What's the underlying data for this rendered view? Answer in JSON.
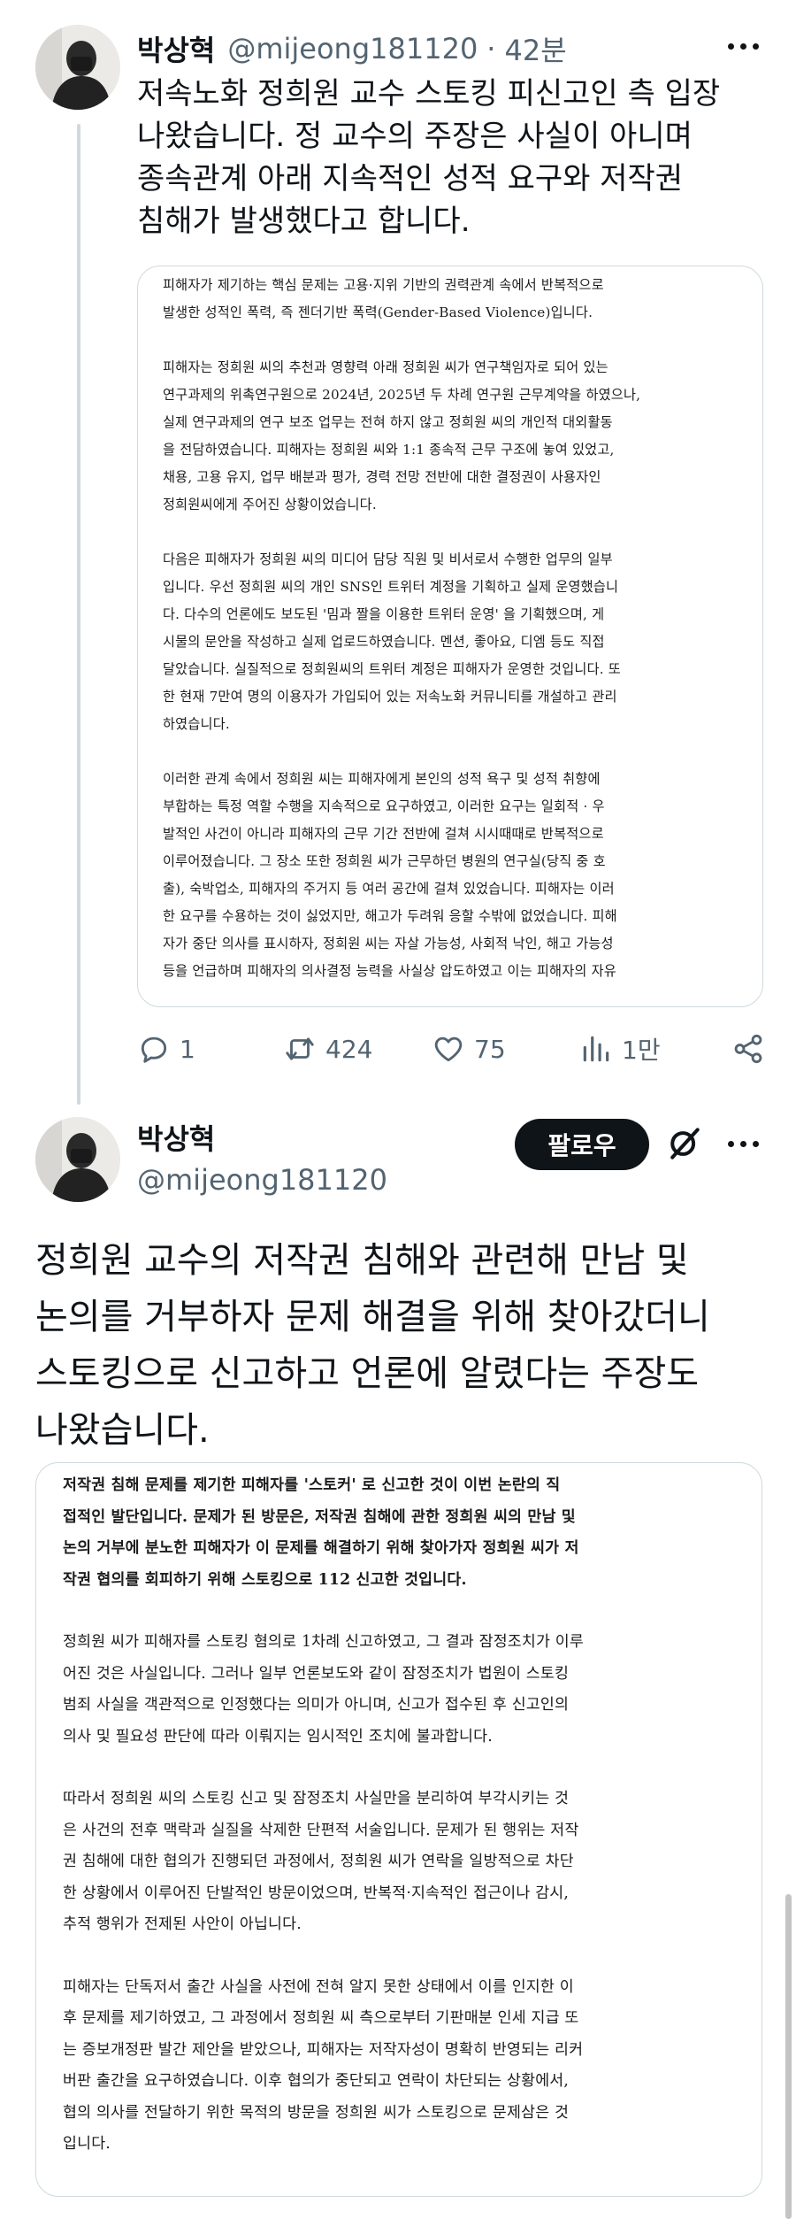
{
  "tweet1": {
    "author_name": "박상혁",
    "author_handle": "@mijeong181120",
    "separator": "·",
    "time": "42분",
    "text": "저속노화 정희원 교수 스토킹 피신고인 측 입장 나왔습니다. 정 교수의 주장은 사실이 아니며 종속관계 아래 지속적인 성적 요구와 저작권 침해가 발생했다고 합니다.",
    "document_paragraphs": [
      [
        "피해자가 제기하는 핵심 문제는 고용·지위 기반의 권력관계 속에서 반복적으로",
        "발생한 성적인 폭력, 즉 젠더기반 폭력(Gender-Based Violence)입니다."
      ],
      [
        "피해자는 정희원 씨의 추천과 영향력 아래 정희원 씨가 연구책임자로 되어 있는",
        "연구과제의 위촉연구원으로 2024년, 2025년 두 차례 연구원 근무계약을 하였으나,",
        "실제 연구과제의 연구 보조 업무는 전혀 하지 않고 정희원 씨의 개인적 대외활동",
        "을 전담하였습니다. 피해자는 정희원 씨와 1:1 종속적 근무 구조에 놓여 있었고,",
        "채용, 고용 유지, 업무 배분과 평가, 경력 전망 전반에 대한 결정권이 사용자인",
        "정희원씨에게 주어진 상황이었습니다."
      ],
      [
        "다음은 피해자가 정희원 씨의 미디어 담당 직원 및 비서로서 수행한 업무의 일부",
        "입니다. 우선 정희원 씨의 개인 SNS인 트위터 계정을 기획하고 실제 운영했습니",
        "다. 다수의 언론에도 보도된 '밈과 짤을 이용한 트위터 운영' 을 기획했으며, 게",
        "시물의 문안을 작성하고 실제 업로드하였습니다. 멘션, 좋아요, 디엠 등도 직접",
        "달았습니다. 실질적으로 정희원씨의 트위터 계정은 피해자가 운영한 것입니다. 또",
        "한 현재 7만여 명의 이용자가 가입되어 있는 저속노화 커뮤니티를 개설하고 관리",
        "하였습니다."
      ],
      [
        "이러한 관계 속에서 정희원 씨는 피해자에게 본인의 성적 욕구 및 성적 취향에",
        "부합하는 특정 역할 수행을 지속적으로 요구하였고, 이러한 요구는 일회적 · 우",
        "발적인 사건이 아니라 피해자의 근무 기간 전반에 걸쳐 시시때때로 반복적으로",
        "이루어졌습니다. 그 장소 또한 정희원 씨가 근무하던 병원의 연구실(당직 중 호",
        "출), 숙박업소, 피해자의 주거지 등 여러 공간에 걸쳐 있었습니다. 피해자는 이러",
        "한 요구를 수용하는 것이 싫었지만, 해고가 두려워 응할 수밖에 없었습니다. 피해",
        "자가 중단 의사를 표시하자, 정희원 씨는 자살 가능성, 사회적 낙인, 해고 가능성",
        "등을 언급하며 피해자의 의사결정 능력을 사실상 압도하였고 이는 피해자의 자유"
      ]
    ],
    "replies": "1",
    "retweets": "424",
    "likes": "75",
    "views": "1만"
  },
  "tweet2": {
    "author_name": "박상혁",
    "author_handle": "@mijeong181120",
    "follow_label": "팔로우",
    "text": "정희원 교수의 저작권 침해와 관련해 만남 및 논의를 거부하자 문제 해결을 위해 찾아갔더니 스토킹으로 신고하고 언론에 알렸다는 주장도 나왔습니다.",
    "document_paragraphs": [
      [
        "저작권 침해 문제를 제기한 피해자를 '스토커' 로 신고한 것이 이번 논란의 직",
        "접적인 발단입니다. 문제가 된 방문은, 저작권 침해에 관한 정희원 씨의 만남 및",
        "논의 거부에 분노한 피해자가 이 문제를 해결하기 위해 찾아가자 정희원 씨가 저",
        "작권 협의를 회피하기 위해 스토킹으로 112 신고한 것입니다."
      ],
      [
        "정희원 씨가 피해자를 스토킹 혐의로 1차례 신고하였고, 그 결과 잠정조치가 이루",
        "어진 것은 사실입니다. 그러나 일부 언론보도와 같이 잠정조치가 법원이 스토킹",
        "범죄 사실을 객관적으로 인정했다는 의미가 아니며, 신고가 접수된 후 신고인의",
        "의사 및 필요성 판단에 따라 이뤄지는 임시적인 조치에 불과합니다."
      ],
      [
        "따라서 정희원 씨의 스토킹 신고 및 잠정조치 사실만을 분리하여 부각시키는 것",
        "은 사건의 전후 맥락과 실질을 삭제한 단편적 서술입니다. 문제가 된 행위는 저작",
        "권 침해에 대한 협의가 진행되던 과정에서, 정희원 씨가 연락을 일방적으로 차단",
        "한 상황에서 이루어진 단발적인 방문이었으며, 반복적·지속적인 접근이나 감시,",
        "추적 행위가 전제된 사안이 아닙니다."
      ],
      [
        "피해자는 단독저서 출간 사실을 사전에 전혀 알지 못한 상태에서 이를 인지한 이",
        "후 문제를 제기하였고, 그 과정에서 정희원 씨 측으로부터 기판매분 인세 지급 또",
        "는 증보개정판 발간 제안을 받았으나, 피해자는 저작자성이 명확히 반영되는 리커",
        "버판 출간을 요구하였습니다. 이후 협의가 중단되고 연락이 차단되는 상황에서,",
        "협의 의사를 전달하기 위한 목적의 방문을 정희원 씨가 스토킹으로 문제삼은 것",
        "입니다."
      ]
    ]
  },
  "icons": [
    "reply-icon",
    "retweet-icon",
    "like-icon",
    "views-icon",
    "share-icon",
    "more-icon",
    "grok-icon"
  ]
}
